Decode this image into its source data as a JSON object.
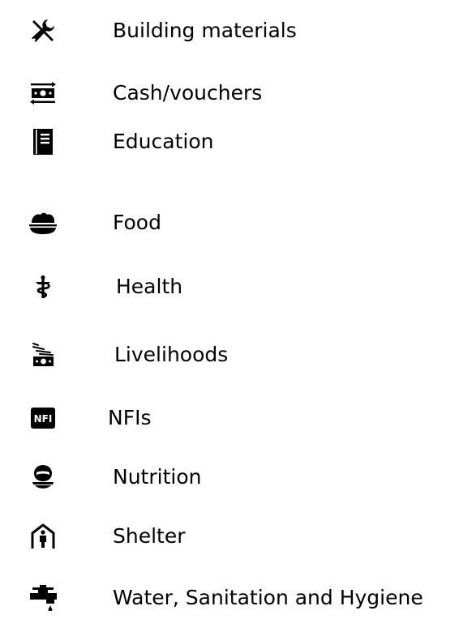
{
  "legend": {
    "items": [
      {
        "label": "Building materials",
        "icon": "tools-icon"
      },
      {
        "label": "Cash/vouchers",
        "icon": "cash-transfer-icon"
      },
      {
        "label": "Education",
        "icon": "education-book-icon"
      },
      {
        "label": "Food",
        "icon": "food-bowl-icon"
      },
      {
        "label": "Health",
        "icon": "health-caduceus-icon"
      },
      {
        "label": "Livelihoods",
        "icon": "livelihoods-icon"
      },
      {
        "label": "NFIs",
        "icon": "nfi-icon",
        "icon_text": "NFI"
      },
      {
        "label": "Nutrition",
        "icon": "nutrition-icon"
      },
      {
        "label": "Shelter",
        "icon": "shelter-icon"
      },
      {
        "label": "Water, Sanitation and Hygiene",
        "icon": "water-tap-icon"
      }
    ]
  },
  "colors": {
    "icon": "#000000",
    "text": "#000000",
    "background": "#ffffff"
  }
}
